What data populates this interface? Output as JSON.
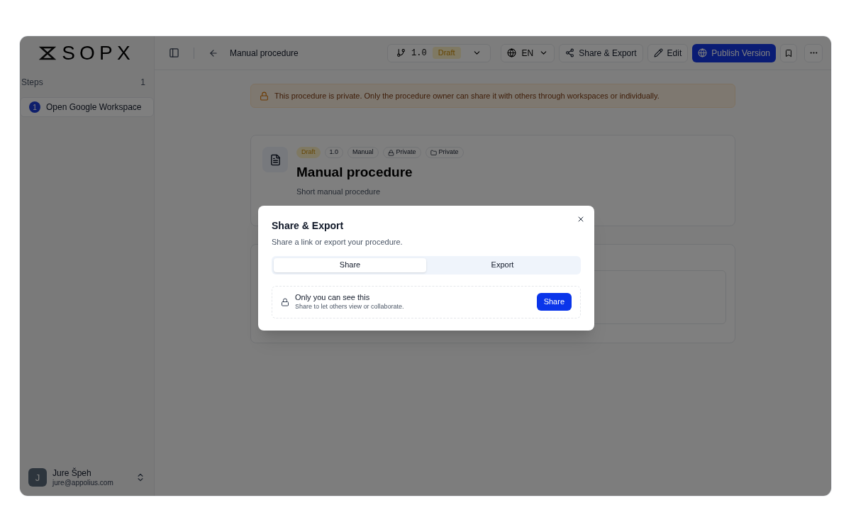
{
  "logo": "SOPX",
  "header": {
    "title": "Manual procedure",
    "version": "1.0",
    "version_status": "Draft",
    "language": "EN",
    "buttons": [
      {
        "label": "Share & Export",
        "kind": "share"
      },
      {
        "label": "Edit",
        "kind": "edit"
      },
      {
        "label": "Publish Version",
        "kind": "publish"
      }
    ]
  },
  "sidebar": {
    "heading": "Steps",
    "count": "1",
    "steps": [
      {
        "number": "1",
        "label": "Open Google Workspace",
        "selected": true
      }
    ],
    "user": {
      "initial": "J",
      "name": "Jure Špeh",
      "email": "jure@appolius.com"
    }
  },
  "notice": "This procedure is private. Only the procedure owner can share it with others through workspaces or individually.",
  "procedure": {
    "badges": [
      {
        "label": "Draft",
        "kind": "status"
      },
      {
        "label": "1.0",
        "kind": "plain"
      },
      {
        "label": "Manual",
        "kind": "plain"
      },
      {
        "label": "Private",
        "kind": "lock"
      },
      {
        "label": "Private",
        "kind": "folder"
      }
    ],
    "title": "Manual procedure",
    "description": "Short manual procedure"
  },
  "dialog": {
    "title": "Share & Export",
    "subtitle": "Share a link or export your procedure.",
    "tabs": [
      {
        "label": "Share",
        "selected": true
      },
      {
        "label": "Export",
        "selected": false
      }
    ],
    "share_panel": {
      "title": "Only you can see this",
      "subtitle": "Share to let others view or collaborate.",
      "button": "Share"
    }
  }
}
